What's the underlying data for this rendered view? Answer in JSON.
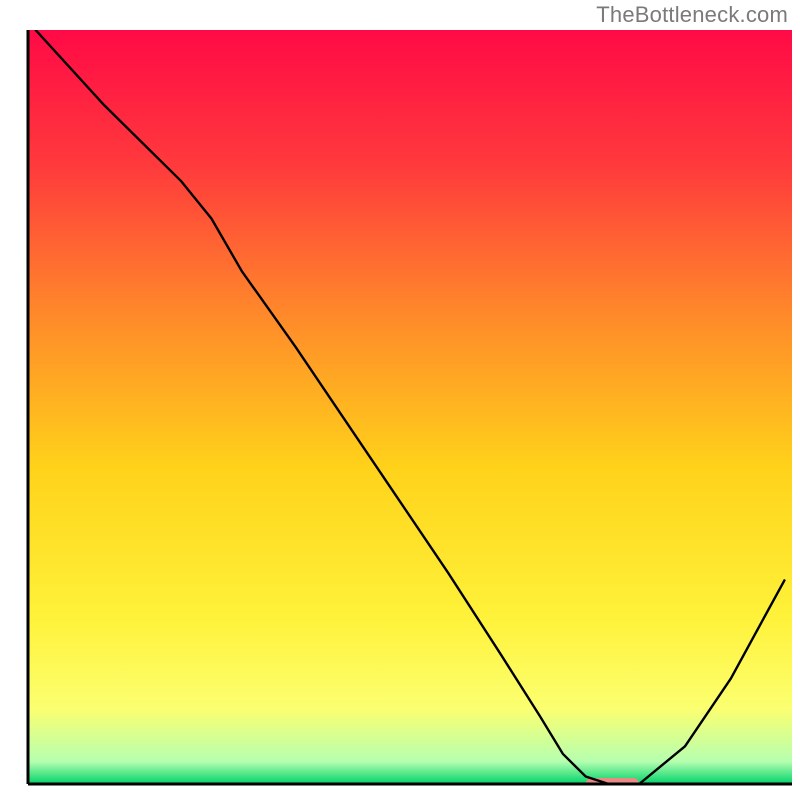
{
  "watermark": "TheBottleneck.com",
  "chart_data": {
    "type": "line",
    "title": "",
    "xlabel": "",
    "ylabel": "",
    "xlim": [
      0,
      100
    ],
    "ylim": [
      0,
      100
    ],
    "grid": false,
    "legend": {
      "visible": false
    },
    "background_gradient_stops": [
      {
        "pos": 0.0,
        "color": "#ff0a46"
      },
      {
        "pos": 0.18,
        "color": "#ff3a3c"
      },
      {
        "pos": 0.38,
        "color": "#ff8a2a"
      },
      {
        "pos": 0.58,
        "color": "#ffd21a"
      },
      {
        "pos": 0.78,
        "color": "#fff23a"
      },
      {
        "pos": 0.9,
        "color": "#fbff70"
      },
      {
        "pos": 0.97,
        "color": "#b6ffb0"
      },
      {
        "pos": 1.0,
        "color": "#00d36a"
      }
    ],
    "series": [
      {
        "name": "curve",
        "color": "#000000",
        "x": [
          1,
          10,
          20,
          24,
          28,
          35,
          45,
          55,
          62,
          67,
          70,
          73,
          76,
          80,
          86,
          92,
          99
        ],
        "y": [
          100,
          90,
          80,
          75,
          68,
          58,
          43,
          28,
          17,
          9,
          4,
          1,
          0,
          0,
          5,
          14,
          27
        ]
      }
    ],
    "marker": {
      "name": "optimal-marker",
      "color": "#e98b84",
      "x_range": [
        73,
        80
      ],
      "y": 0
    },
    "axes": {
      "left": {
        "visible": true,
        "color": "#000000"
      },
      "bottom": {
        "visible": true,
        "color": "#000000"
      },
      "right": {
        "visible": false
      },
      "top": {
        "visible": false
      }
    }
  }
}
